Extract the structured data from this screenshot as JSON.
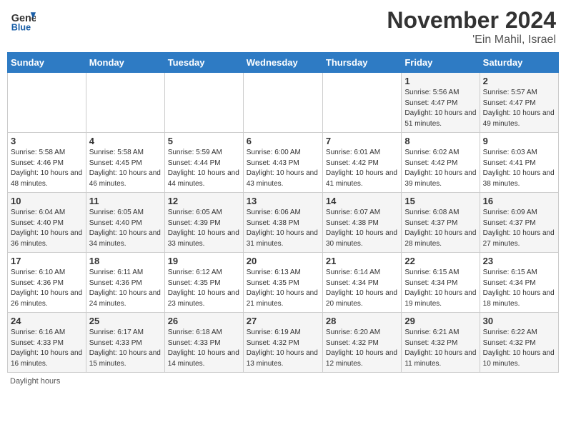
{
  "header": {
    "logo_general": "General",
    "logo_blue": "Blue",
    "month": "November 2024",
    "location": "'Ein Mahil, Israel"
  },
  "days_of_week": [
    "Sunday",
    "Monday",
    "Tuesday",
    "Wednesday",
    "Thursday",
    "Friday",
    "Saturday"
  ],
  "weeks": [
    [
      {
        "day": "",
        "info": ""
      },
      {
        "day": "",
        "info": ""
      },
      {
        "day": "",
        "info": ""
      },
      {
        "day": "",
        "info": ""
      },
      {
        "day": "",
        "info": ""
      },
      {
        "day": "1",
        "info": "Sunrise: 5:56 AM\nSunset: 4:47 PM\nDaylight: 10 hours and 51 minutes."
      },
      {
        "day": "2",
        "info": "Sunrise: 5:57 AM\nSunset: 4:47 PM\nDaylight: 10 hours and 49 minutes."
      }
    ],
    [
      {
        "day": "3",
        "info": "Sunrise: 5:58 AM\nSunset: 4:46 PM\nDaylight: 10 hours and 48 minutes."
      },
      {
        "day": "4",
        "info": "Sunrise: 5:58 AM\nSunset: 4:45 PM\nDaylight: 10 hours and 46 minutes."
      },
      {
        "day": "5",
        "info": "Sunrise: 5:59 AM\nSunset: 4:44 PM\nDaylight: 10 hours and 44 minutes."
      },
      {
        "day": "6",
        "info": "Sunrise: 6:00 AM\nSunset: 4:43 PM\nDaylight: 10 hours and 43 minutes."
      },
      {
        "day": "7",
        "info": "Sunrise: 6:01 AM\nSunset: 4:42 PM\nDaylight: 10 hours and 41 minutes."
      },
      {
        "day": "8",
        "info": "Sunrise: 6:02 AM\nSunset: 4:42 PM\nDaylight: 10 hours and 39 minutes."
      },
      {
        "day": "9",
        "info": "Sunrise: 6:03 AM\nSunset: 4:41 PM\nDaylight: 10 hours and 38 minutes."
      }
    ],
    [
      {
        "day": "10",
        "info": "Sunrise: 6:04 AM\nSunset: 4:40 PM\nDaylight: 10 hours and 36 minutes."
      },
      {
        "day": "11",
        "info": "Sunrise: 6:05 AM\nSunset: 4:40 PM\nDaylight: 10 hours and 34 minutes."
      },
      {
        "day": "12",
        "info": "Sunrise: 6:05 AM\nSunset: 4:39 PM\nDaylight: 10 hours and 33 minutes."
      },
      {
        "day": "13",
        "info": "Sunrise: 6:06 AM\nSunset: 4:38 PM\nDaylight: 10 hours and 31 minutes."
      },
      {
        "day": "14",
        "info": "Sunrise: 6:07 AM\nSunset: 4:38 PM\nDaylight: 10 hours and 30 minutes."
      },
      {
        "day": "15",
        "info": "Sunrise: 6:08 AM\nSunset: 4:37 PM\nDaylight: 10 hours and 28 minutes."
      },
      {
        "day": "16",
        "info": "Sunrise: 6:09 AM\nSunset: 4:37 PM\nDaylight: 10 hours and 27 minutes."
      }
    ],
    [
      {
        "day": "17",
        "info": "Sunrise: 6:10 AM\nSunset: 4:36 PM\nDaylight: 10 hours and 26 minutes."
      },
      {
        "day": "18",
        "info": "Sunrise: 6:11 AM\nSunset: 4:36 PM\nDaylight: 10 hours and 24 minutes."
      },
      {
        "day": "19",
        "info": "Sunrise: 6:12 AM\nSunset: 4:35 PM\nDaylight: 10 hours and 23 minutes."
      },
      {
        "day": "20",
        "info": "Sunrise: 6:13 AM\nSunset: 4:35 PM\nDaylight: 10 hours and 21 minutes."
      },
      {
        "day": "21",
        "info": "Sunrise: 6:14 AM\nSunset: 4:34 PM\nDaylight: 10 hours and 20 minutes."
      },
      {
        "day": "22",
        "info": "Sunrise: 6:15 AM\nSunset: 4:34 PM\nDaylight: 10 hours and 19 minutes."
      },
      {
        "day": "23",
        "info": "Sunrise: 6:15 AM\nSunset: 4:34 PM\nDaylight: 10 hours and 18 minutes."
      }
    ],
    [
      {
        "day": "24",
        "info": "Sunrise: 6:16 AM\nSunset: 4:33 PM\nDaylight: 10 hours and 16 minutes."
      },
      {
        "day": "25",
        "info": "Sunrise: 6:17 AM\nSunset: 4:33 PM\nDaylight: 10 hours and 15 minutes."
      },
      {
        "day": "26",
        "info": "Sunrise: 6:18 AM\nSunset: 4:33 PM\nDaylight: 10 hours and 14 minutes."
      },
      {
        "day": "27",
        "info": "Sunrise: 6:19 AM\nSunset: 4:32 PM\nDaylight: 10 hours and 13 minutes."
      },
      {
        "day": "28",
        "info": "Sunrise: 6:20 AM\nSunset: 4:32 PM\nDaylight: 10 hours and 12 minutes."
      },
      {
        "day": "29",
        "info": "Sunrise: 6:21 AM\nSunset: 4:32 PM\nDaylight: 10 hours and 11 minutes."
      },
      {
        "day": "30",
        "info": "Sunrise: 6:22 AM\nSunset: 4:32 PM\nDaylight: 10 hours and 10 minutes."
      }
    ]
  ],
  "footer": {
    "note": "Daylight hours"
  }
}
